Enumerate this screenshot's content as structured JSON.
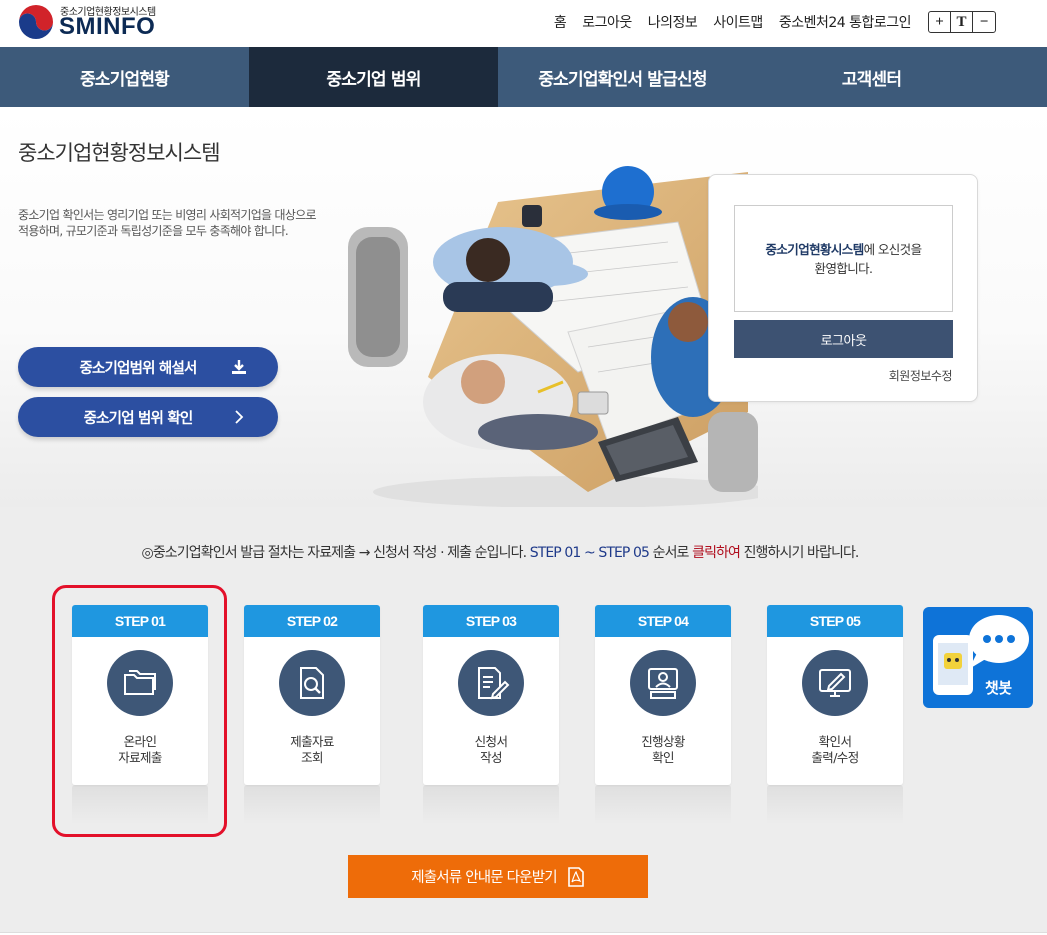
{
  "header": {
    "logo_sub": "중소기업현황정보시스템",
    "logo_main": "SMINFO",
    "util_links": [
      "홈",
      "로그아웃",
      "나의정보",
      "사이트맵",
      "중소벤처24 통합로그인"
    ],
    "font_controls": [
      "+",
      "T",
      "−"
    ]
  },
  "nav": {
    "items": [
      "중소기업현황",
      "중소기업 범위",
      "중소기업확인서 발급신청",
      "고객센터"
    ],
    "active_index": 1
  },
  "hero": {
    "title": "중소기업현황정보시스템",
    "description": "중소기업 확인서는 영리기업 또는 비영리 사회적기업을 대상으로 적용하며, 규모기준과 독립성기준을 모두 충족해야 합니다.",
    "buttons": [
      {
        "label": "중소기업범위 해설서",
        "icon": "download-icon"
      },
      {
        "label": "중소기업 범위 확인",
        "icon": "chevron-right-icon"
      }
    ]
  },
  "login": {
    "welcome_strong": "중소기업현황시스템",
    "welcome_rest": "에 오신것을",
    "welcome_line2": "환영합니다.",
    "logout_label": "로그아웃",
    "edit_label": "회원정보수정"
  },
  "steps": {
    "notice_prefix": "◎중소기업확인서 발급 절차는 자료제출 → 신청서 작성 · 제출 순입니다. ",
    "notice_blue": "STEP 01 ~ STEP 05",
    "notice_mid": " 순서로 ",
    "notice_red": "클릭하여",
    "notice_suffix": " 진행하시기 바랍니다.",
    "items": [
      {
        "step": "STEP 01",
        "label": "온라인\n자료제출",
        "icon": "folder-icon"
      },
      {
        "step": "STEP 02",
        "label": "제출자료\n조회",
        "icon": "document-search-icon"
      },
      {
        "step": "STEP 03",
        "label": "신청서\n작성",
        "icon": "document-edit-icon"
      },
      {
        "step": "STEP 04",
        "label": "진행상황\n확인",
        "icon": "monitor-user-icon"
      },
      {
        "step": "STEP 05",
        "label": "확인서\n출력/수정",
        "icon": "monitor-edit-icon"
      }
    ],
    "chatbot_label": "챗봇",
    "download_label": "제출서류 안내문 다운받기"
  },
  "colors": {
    "nav_bg": "#3d5a7a",
    "nav_active": "#1c2a3c",
    "hero_button": "#2c4fa1",
    "step_head": "#1f97e0",
    "step_circle": "#3e5777",
    "download_btn": "#ee6c09",
    "highlight": "#e3102a",
    "chatbot": "#0e73d8"
  }
}
